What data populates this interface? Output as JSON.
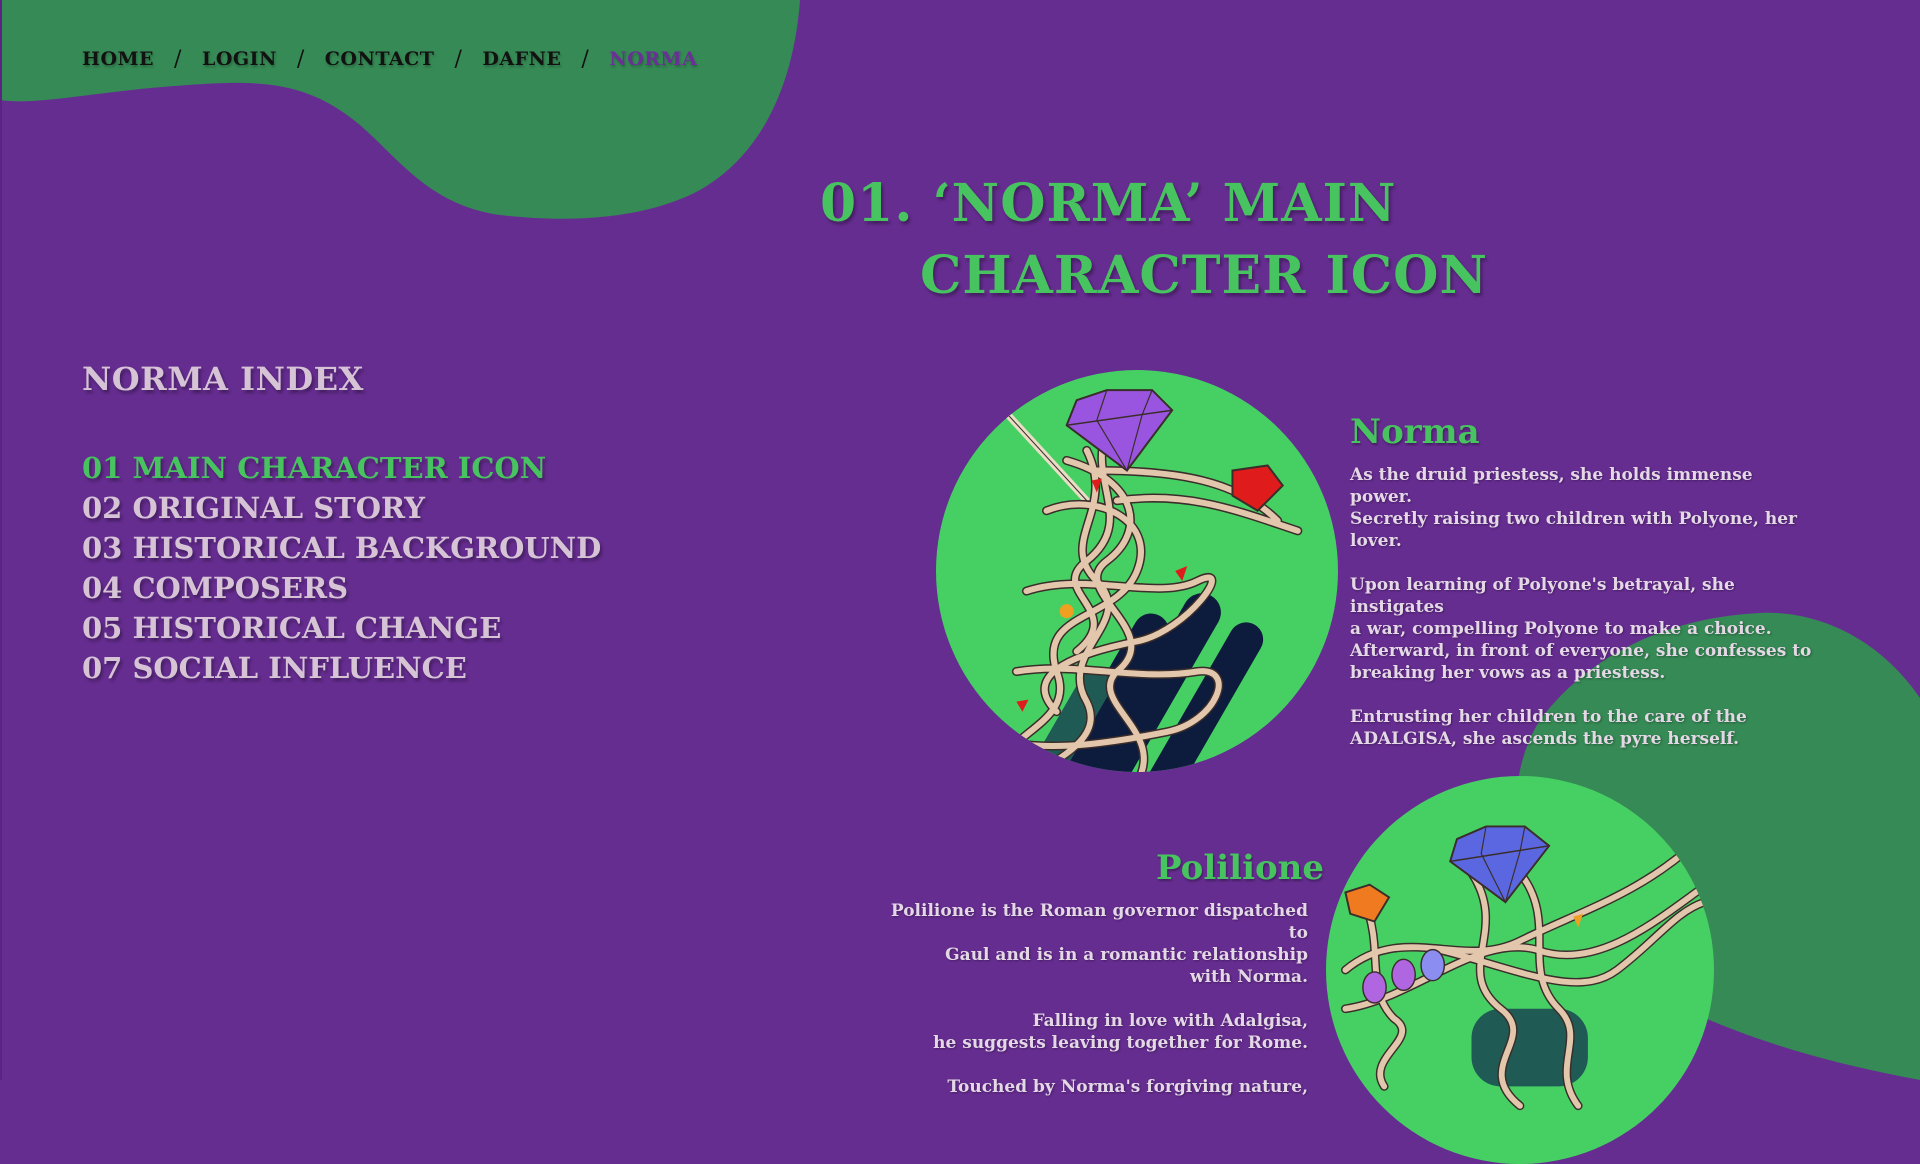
{
  "nav": {
    "items": [
      "HOME",
      "LOGIN",
      "CONTACT",
      "DAFNE",
      "NORMA"
    ],
    "separator": "/",
    "current": "NORMA"
  },
  "page_title": {
    "line1": "01. ‘NORMA’ MAIN",
    "line2": "CHARACTER ICON"
  },
  "index": {
    "title": "NORMA INDEX",
    "items": [
      "01 MAIN CHARACTER ICON",
      "02 ORIGINAL STORY",
      "03 HISTORICAL BACKGROUND",
      "04 COMPOSERS",
      "05 HISTORICAL CHANGE",
      "07 SOCIAL INFLUENCE"
    ]
  },
  "characters": [
    {
      "name": "Norma",
      "paragraphs": [
        "As the druid priestess, she holds immense power.\nSecretly raising two children with Polyone, her\nlover.",
        "Upon learning of Polyone's betrayal, she instigates\na war, compelling Polyone to make a choice.\nAfterward, in front of everyone, she confesses to\nbreaking her vows as a priestess.",
        "Entrusting her children to the care of the\nADALGISA, she ascends the pyre herself."
      ]
    },
    {
      "name": "Polilione",
      "paragraphs": [
        "Polilione is the Roman governor dispatched to\nGaul and is in a romantic relationship\nwith Norma.",
        "Falling in love with Adalgisa,\nhe suggests leaving together for Rome.",
        "Touched by Norma's forgiving nature,"
      ]
    }
  ],
  "colors": {
    "background": "#662d91",
    "blob": "#368a55",
    "accent_green": "#47c45f",
    "index_text": "#d6c4d6",
    "nav_text": "#121212",
    "nav_current": "#6b2f98"
  },
  "icons": [
    "norma-jewel-figure-icon",
    "polilione-jewel-figure-icon"
  ]
}
